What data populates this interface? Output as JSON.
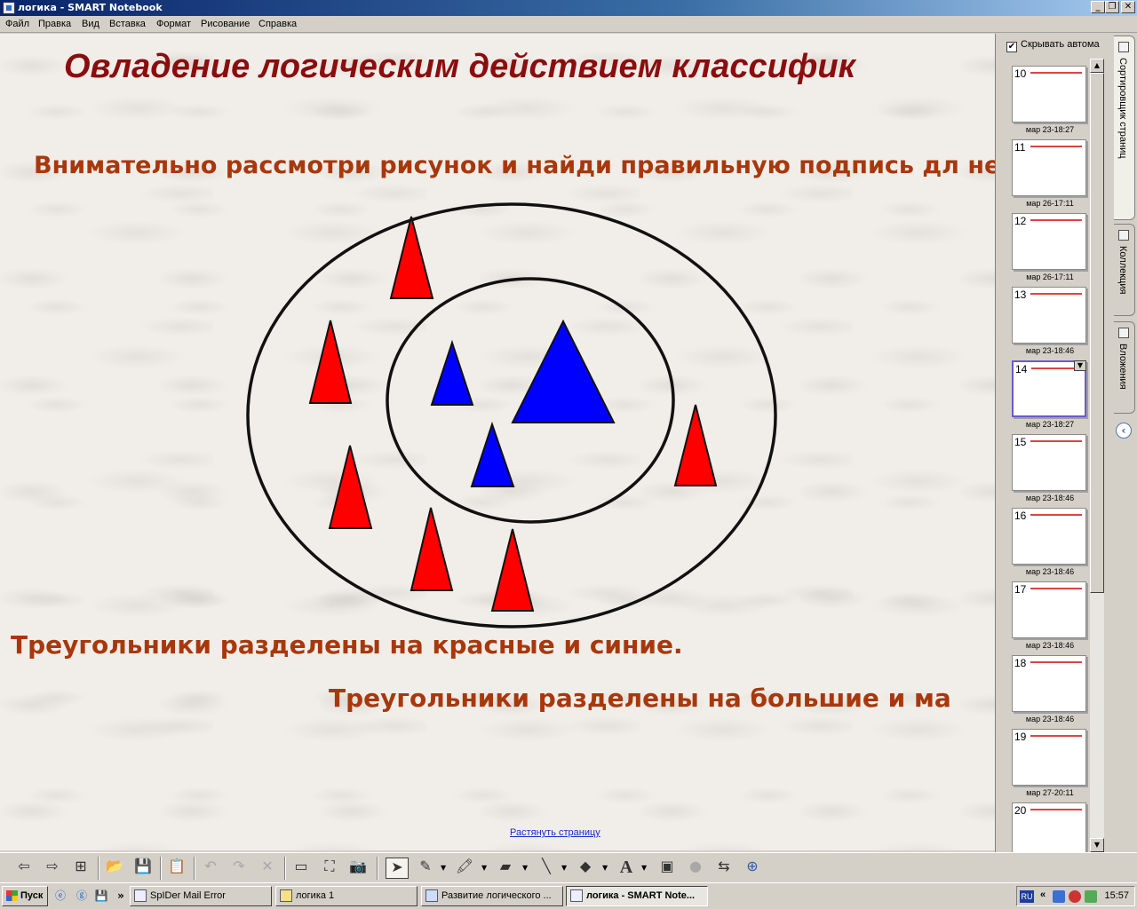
{
  "window": {
    "title": "логика - SMART Notebook",
    "controls": [
      "minimize",
      "restore",
      "close"
    ]
  },
  "menu": [
    "Файл",
    "Правка",
    "Вид",
    "Вставка",
    "Формат",
    "Рисование",
    "Справка"
  ],
  "page": {
    "title": "Овладение логическим действием классифик",
    "instruction": "Внимательно рассмотри рисунок и найди правильную подпись дл него.",
    "answer1": "Треугольники разделены на красные и синие.",
    "answer2": "Треугольники разделены на большие и ма",
    "stretch_link": "Растянуть страницу",
    "colors": {
      "title": "#8b0d0d",
      "text": "#a8380c",
      "red_triangle": "#ff0000",
      "blue_triangle": "#0000ff"
    }
  },
  "sidebar": {
    "autohide_label": "Скрывать автома",
    "autohide_checked": true,
    "thumbnails": [
      {
        "num": "10",
        "date": "мар 23-18:27",
        "selected": false
      },
      {
        "num": "11",
        "date": "мар 26-17:11",
        "selected": false
      },
      {
        "num": "12",
        "date": "мар 26-17:11",
        "selected": false
      },
      {
        "num": "13",
        "date": "мар 23-18:46",
        "selected": false
      },
      {
        "num": "14",
        "date": "мар 23-18:27",
        "selected": true
      },
      {
        "num": "15",
        "date": "мар 23-18:46",
        "selected": false
      },
      {
        "num": "16",
        "date": "мар 23-18:46",
        "selected": false
      },
      {
        "num": "17",
        "date": "мар 23-18:46",
        "selected": false
      },
      {
        "num": "18",
        "date": "мар 23-18:46",
        "selected": false
      },
      {
        "num": "19",
        "date": "мар 27-20:11",
        "selected": false
      },
      {
        "num": "20",
        "date": "",
        "selected": false
      }
    ],
    "tabs": [
      "Сортировщик страниц",
      "Коллекция",
      "Вложения"
    ]
  },
  "toolbar": {
    "icons": [
      "back-icon",
      "forward-icon",
      "add-page-icon",
      "open-icon",
      "save-icon",
      "paste-icon",
      "undo-icon",
      "redo-icon",
      "delete-icon",
      "screen-shade-icon",
      "fullscreen-icon",
      "capture-icon",
      "select-icon",
      "pen-icon",
      "highlighter-icon",
      "eraser-icon",
      "line-icon",
      "shapes-icon",
      "text-icon",
      "fill-icon",
      "properties-icon",
      "move-toolbar-icon",
      "help-icon"
    ],
    "text_tool": "A"
  },
  "taskbar": {
    "start": "Пуск",
    "more": "»",
    "tasks": [
      {
        "label": "SpIDer Mail Error",
        "active": false
      },
      {
        "label": "логика 1",
        "active": false
      },
      {
        "label": "Развитие логического ...",
        "active": false
      },
      {
        "label": "логика - SMART Note...",
        "active": true
      }
    ],
    "lang": "RU",
    "tray_more": "«",
    "clock": "15:57"
  }
}
